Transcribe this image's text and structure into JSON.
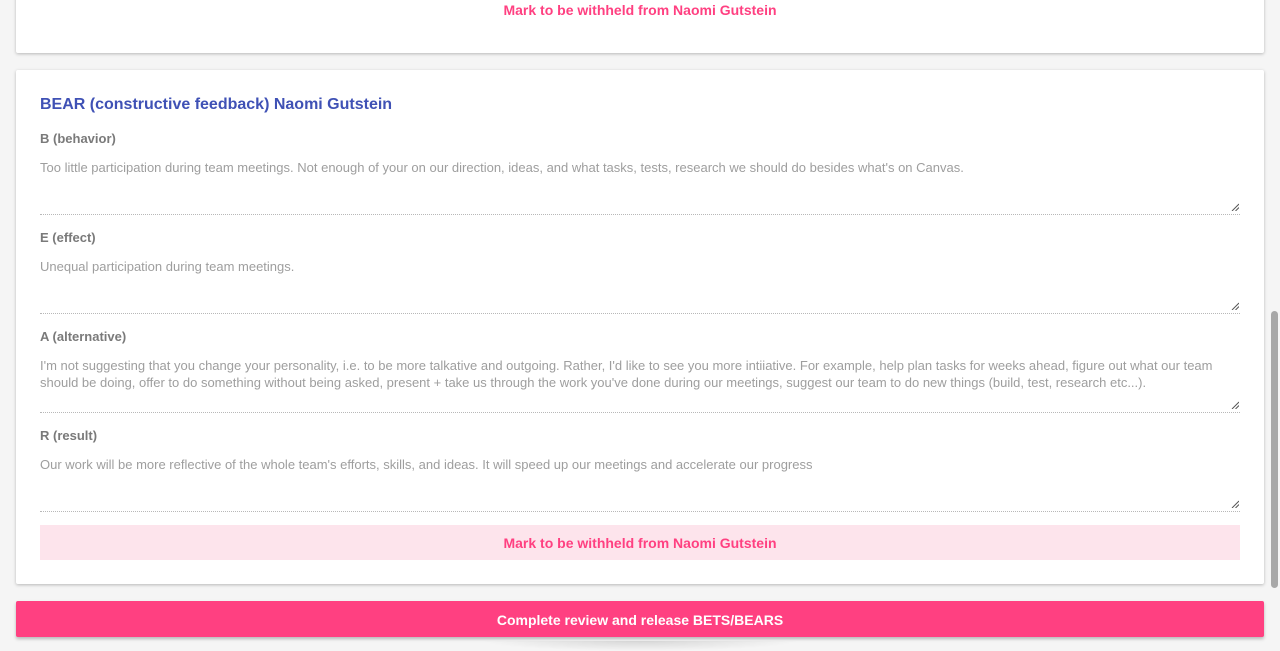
{
  "top_card": {
    "withhold_label": "Mark to be withheld from Naomi Gutstein"
  },
  "bear_card": {
    "title": "BEAR (constructive feedback) Naomi Gutstein",
    "fields": [
      {
        "label": "B (behavior)",
        "value": "Too little participation during team meetings. Not enough of your on our direction, ideas, and what tasks, tests, research we should do besides what's on Canvas."
      },
      {
        "label": "E (effect)",
        "value": "Unequal participation during team meetings."
      },
      {
        "label": "A (alternative)",
        "value": "I'm not suggesting that you change your personality, i.e.  to be more talkative and outgoing. Rather, I'd like to see you more intiiative. For example, help plan tasks for weeks ahead, figure out what our team should be doing, offer to do something without being asked, present + take us through the work you've done during our meetings, suggest our team to do new things (build, test, research etc...)."
      },
      {
        "label": "R (result)",
        "value": "Our work will be more reflective of the whole team's efforts, skills, and ideas. It will speed up our meetings and accelerate our progress"
      }
    ],
    "withhold_label": "Mark to be withheld from Naomi Gutstein"
  },
  "footer": {
    "complete_label": "Complete review and release BETS/BEARS"
  },
  "colors": {
    "accent": "#ff4081",
    "accent_light": "#fde4ec",
    "title": "#3f51b5"
  },
  "icons": {
    "resize": "resize-handle-icon"
  }
}
